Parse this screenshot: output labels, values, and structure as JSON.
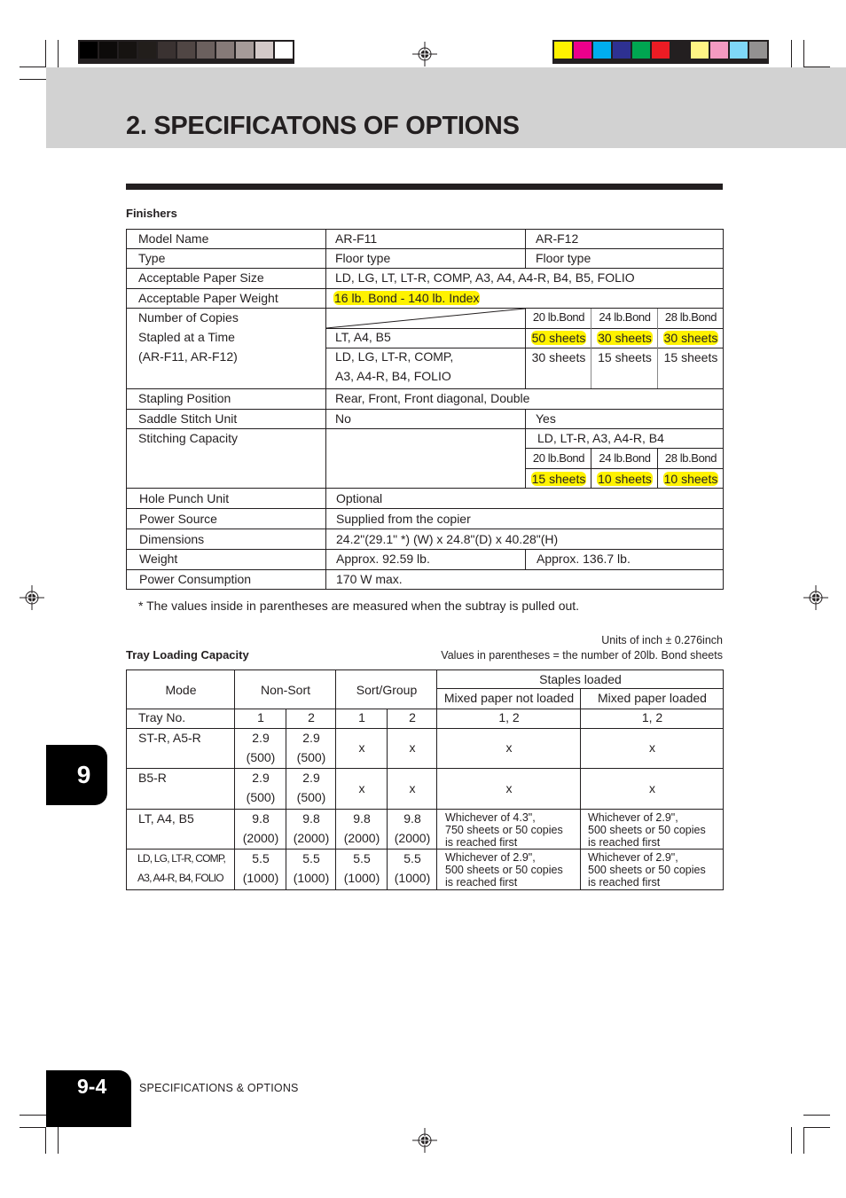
{
  "print_marks": {
    "gray_swatches": [
      "#000000",
      "#0d0b0a",
      "#161311",
      "#221e1b",
      "#3a3231",
      "#504644",
      "#6b605e",
      "#867a78",
      "#a69b99",
      "#d3c9c8",
      "#ffffff"
    ],
    "color_swatches": [
      "#fff200",
      "#ec008c",
      "#00aeef",
      "#2e3192",
      "#00a651",
      "#ed1c24",
      "#231f20",
      "#fff685",
      "#f49ac1",
      "#7fd8f8",
      "#939191"
    ]
  },
  "header": {
    "title": "2. SPECIFICATONS OF OPTIONS"
  },
  "finishers": {
    "section_title": "Finishers",
    "model_name": {
      "label": "Model Name",
      "arf11": "AR-F11",
      "arf12": "AR-F12"
    },
    "type": {
      "label": "Type",
      "arf11": "Floor type",
      "arf12": "Floor type"
    },
    "paper_size": {
      "label": "Acceptable Paper Size",
      "value": "LD, LG, LT, LT-R, COMP, A3, A4, A4-R, B4, B5, FOLIO"
    },
    "paper_weight": {
      "label": "Acceptable Paper Weight",
      "value": "16 lb. Bond - 140 lb. Index"
    },
    "copies_stapled": {
      "label_lines": [
        "Number of Copies",
        "Stapled at a Time",
        "(AR-F11, AR-F12)"
      ],
      "weights": [
        "20 lb.Bond",
        "24 lb.Bond",
        "28 lb.Bond"
      ],
      "rows": [
        {
          "sizes_lines": [
            "LT, A4, B5"
          ],
          "values": [
            "50 sheets",
            "30 sheets",
            "30 sheets"
          ],
          "highlighted": true
        },
        {
          "sizes_lines": [
            "LD, LG, LT-R, COMP,",
            "A3, A4-R, B4, FOLIO"
          ],
          "values": [
            "30 sheets",
            "15 sheets",
            "15 sheets"
          ],
          "highlighted": false
        }
      ]
    },
    "stapling_position": {
      "label": "Stapling Position",
      "value": "Rear, Front, Front diagonal, Double"
    },
    "saddle_stitch": {
      "label": "Saddle Stitch Unit",
      "arf11": "No",
      "arf12": "Yes"
    },
    "stitching_capacity": {
      "label": "Stitching Capacity",
      "sizes": "LD, LT-R, A3, A4-R, B4",
      "weights": [
        "20 lb.Bond",
        "24 lb.Bond",
        "28 lb.Bond"
      ],
      "values": [
        "15 sheets",
        "10 sheets",
        "10 sheets"
      ]
    },
    "hole_punch": {
      "label": "Hole Punch Unit",
      "value": "Optional"
    },
    "power_source": {
      "label": "Power Source",
      "value": "Supplied from the copier"
    },
    "dimensions": {
      "label": "Dimensions",
      "value": "24.2\"(29.1\" *) (W) x 24.8\"(D) x 40.28\"(H)"
    },
    "weight": {
      "label": "Weight",
      "arf11": "Approx. 92.59 lb.",
      "arf12": "Approx. 136.7 lb."
    },
    "power_consumption": {
      "label": "Power Consumption",
      "value": "170 W max."
    },
    "footnote": "* The values inside in parentheses are measured when the subtray is pulled out."
  },
  "tray_capacity": {
    "section_title": "Tray Loading Capacity",
    "units_note": "Units of inch ± 0.276inch",
    "values_note": "Values in parentheses = the number of 20lb. Bond sheets",
    "headers": {
      "mode": "Mode",
      "non_sort": "Non-Sort",
      "sort_group": "Sort/Group",
      "staples_loaded": "Staples loaded",
      "mixed_not_loaded": "Mixed paper not loaded",
      "mixed_loaded": "Mixed paper loaded"
    },
    "tray_row": {
      "label": "Tray No.",
      "values": [
        "1",
        "2",
        "1",
        "2",
        "1, 2",
        "1, 2"
      ]
    },
    "rows": [
      {
        "size_lines": [
          "ST-R, A5-R"
        ],
        "nonsort1": [
          "2.9",
          "(500)"
        ],
        "nonsort2": [
          "2.9",
          "(500)"
        ],
        "sort1": "x",
        "sort2": "x",
        "mixed_not": "x",
        "mixed": "x"
      },
      {
        "size_lines": [
          "B5-R"
        ],
        "nonsort1": [
          "2.9",
          "(500)"
        ],
        "nonsort2": [
          "2.9",
          "(500)"
        ],
        "sort1": "x",
        "sort2": "x",
        "mixed_not": "x",
        "mixed": "x"
      },
      {
        "size_lines": [
          "LT, A4, B5"
        ],
        "nonsort1": [
          "9.8",
          "(2000)"
        ],
        "nonsort2": [
          "9.8",
          "(2000)"
        ],
        "sort1": [
          "9.8",
          "(2000)"
        ],
        "sort2": [
          "9.8",
          "(2000)"
        ],
        "mixed_not": [
          "Whichever of 4.3\",",
          "750 sheets or 50 copies",
          "is reached first"
        ],
        "mixed": [
          "Whichever of 2.9\",",
          "500 sheets or 50 copies",
          "is reached first"
        ]
      },
      {
        "size_lines": [
          "LD, LG, LT-R, COMP,",
          "A3, A4-R, B4, FOLIO"
        ],
        "nonsort1": [
          "5.5",
          "(1000)"
        ],
        "nonsort2": [
          "5.5",
          "(1000)"
        ],
        "sort1": [
          "5.5",
          "(1000)"
        ],
        "sort2": [
          "5.5",
          "(1000)"
        ],
        "mixed_not": [
          "Whichever of 2.9\",",
          "500 sheets or 50 copies",
          "is reached first"
        ],
        "mixed": [
          "Whichever of 2.9\",",
          "500 sheets or 50 copies",
          "is reached first"
        ]
      }
    ]
  },
  "chapter_tab": "9",
  "footer": {
    "page_number": "9-4",
    "section_label": "SPECIFICATIONS & OPTIONS"
  }
}
